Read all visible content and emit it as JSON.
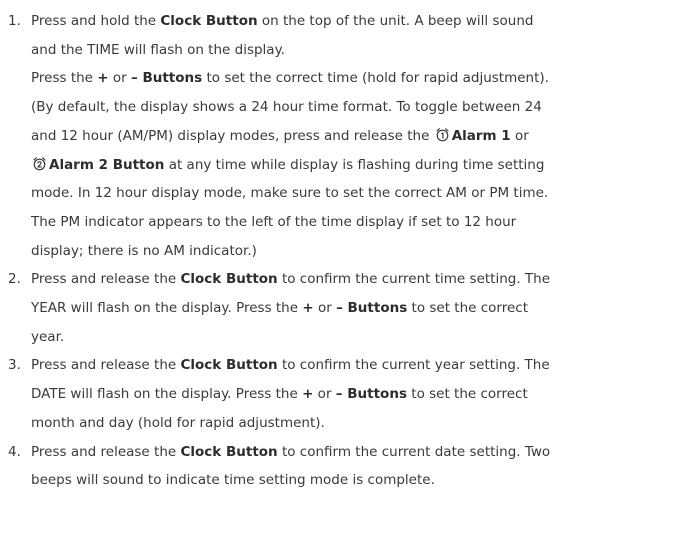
{
  "instructions": [
    {
      "number": "1.",
      "lines": [
        [
          {
            "t": "Press and hold the "
          },
          {
            "t": "Clock Button",
            "b": true
          },
          {
            "t": " on the top of the unit.  A beep will sound"
          }
        ],
        [
          {
            "t": "and the TIME will flash on the display."
          }
        ],
        [
          {
            "t": "Press the "
          },
          {
            "t": "+",
            "b": true
          },
          {
            "t": " or "
          },
          {
            "t": "– Buttons",
            "b": true
          },
          {
            "t": " to set the correct time (hold for rapid adjustment)."
          }
        ],
        [
          {
            "t": "(By default, the display shows a 24 hour time format. To toggle between 24"
          }
        ],
        [
          {
            "t": "and 12 hour (AM/PM) display modes, press and release the "
          },
          {
            "icon": "alarm-1-icon"
          },
          {
            "t": "Alarm  1",
            "b": true
          },
          {
            "t": " or"
          }
        ],
        [
          {
            "icon": "alarm-2-icon"
          },
          {
            "t": "Alarm 2 Button",
            "b": true
          },
          {
            "t": "  at any time while display is flashing during time setting"
          }
        ],
        [
          {
            "t": "mode. In 12 hour display mode, make sure to set the correct AM or PM time."
          }
        ],
        [
          {
            "t": "The PM indicator appears to the left of the time display if set to 12 hour"
          }
        ],
        [
          {
            "t": "display; there is no AM indicator.)"
          }
        ]
      ]
    },
    {
      "number": "2.",
      "lines": [
        [
          {
            "t": "Press and release the "
          },
          {
            "t": "Clock Button",
            "b": true
          },
          {
            "t": " to confirm the current time setting. The"
          }
        ],
        [
          {
            "t": "YEAR will flash on the display. Press the "
          },
          {
            "t": "+",
            "b": true
          },
          {
            "t": " or "
          },
          {
            "t": "– Buttons",
            "b": true
          },
          {
            "t": " to set the correct"
          }
        ],
        [
          {
            "t": "year."
          }
        ]
      ]
    },
    {
      "number": "3.",
      "lines": [
        [
          {
            "t": "Press and release the "
          },
          {
            "t": "Clock Button",
            "b": true
          },
          {
            "t": " to confirm the current year setting. The"
          }
        ],
        [
          {
            "t": "DATE will flash on the display. Press the "
          },
          {
            "t": "+",
            "b": true
          },
          {
            "t": " or "
          },
          {
            "t": "– Buttons",
            "b": true
          },
          {
            "t": " to set the correct"
          }
        ],
        [
          {
            "t": "month and day (hold for rapid adjustment)."
          }
        ]
      ]
    },
    {
      "number": "4.",
      "lines": [
        [
          {
            "t": "Press and release the "
          },
          {
            "t": "Clock Button",
            "b": true
          },
          {
            "t": " to confirm the current date setting. Two"
          }
        ],
        [
          {
            "t": "beeps will sound to indicate time setting mode is complete."
          }
        ]
      ]
    }
  ]
}
